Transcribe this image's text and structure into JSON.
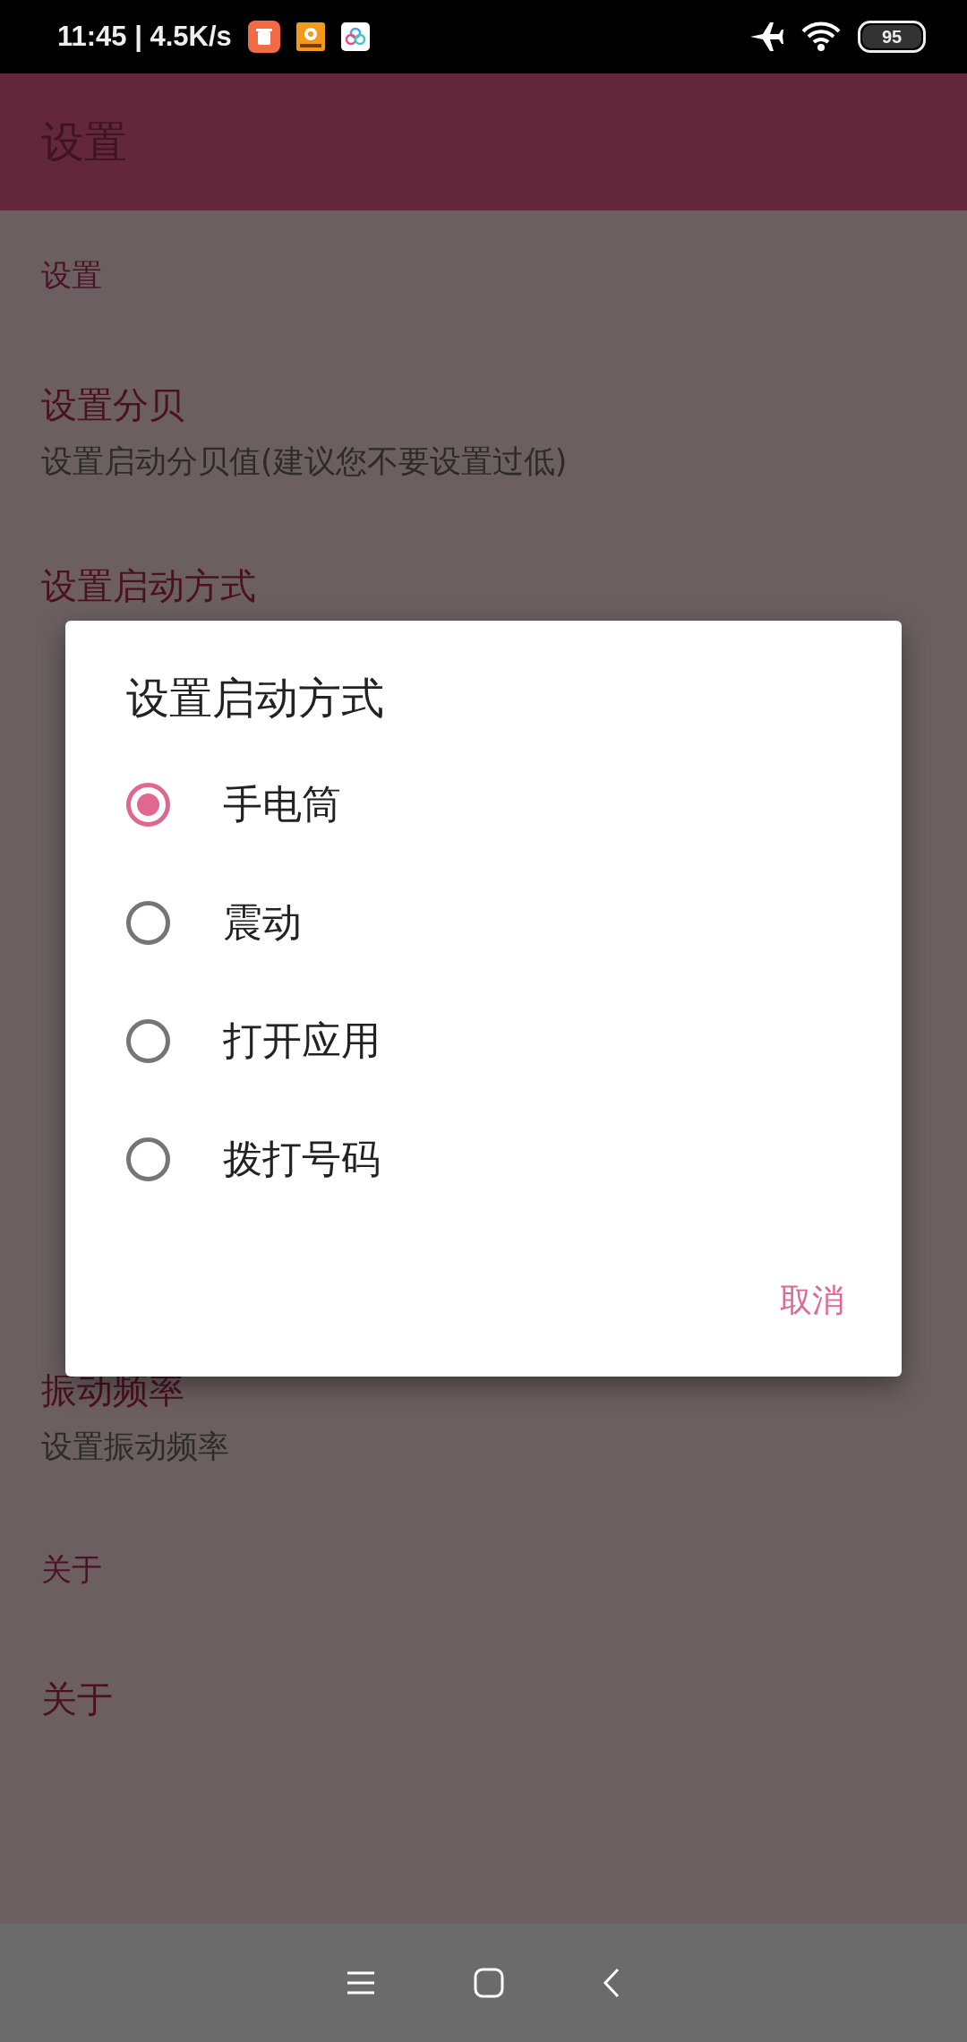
{
  "status_bar": {
    "time": "11:45 | 4.5K/s",
    "battery": "95"
  },
  "app_bar": {
    "title": "设置"
  },
  "list": [
    {
      "kind": "header",
      "title": "设置"
    },
    {
      "kind": "item",
      "title": "设置分贝",
      "subtitle": "设置启动分贝值(建议您不要设置过低)"
    },
    {
      "kind": "item",
      "title": "设置启动方式"
    },
    {
      "kind": "item",
      "title": "振动频率",
      "subtitle": "设置振动频率"
    },
    {
      "kind": "header",
      "title": "关于"
    },
    {
      "kind": "item",
      "title": "关于"
    }
  ],
  "dialog": {
    "title": "设置启动方式",
    "options": [
      {
        "label": "手电筒",
        "selected": true
      },
      {
        "label": "震动",
        "selected": false
      },
      {
        "label": "打开应用",
        "selected": false
      },
      {
        "label": "拨打号码",
        "selected": false
      }
    ],
    "buttons": [
      "取消"
    ]
  }
}
